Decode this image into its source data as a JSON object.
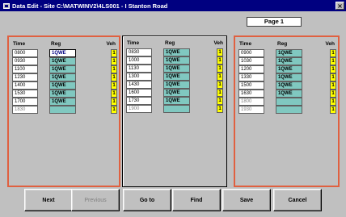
{
  "window": {
    "title": "Data Edit - Site C:\\MATWINV2\\4LS001 - I Stanton Road",
    "close": "×"
  },
  "page_label": "Page 1",
  "headers": {
    "time": "Time",
    "reg": "Reg",
    "veh": "Veh"
  },
  "panels": [
    {
      "rows": [
        {
          "time": "0800",
          "reg": "1QWE",
          "veh": "1",
          "sel": true
        },
        {
          "time": "0930",
          "reg": "1QWE",
          "veh": "1"
        },
        {
          "time": "1100",
          "reg": "1QWE",
          "veh": "1"
        },
        {
          "time": "1230",
          "reg": "1QWE",
          "veh": "1"
        },
        {
          "time": "1400",
          "reg": "1QWE",
          "veh": "1"
        },
        {
          "time": "1530",
          "reg": "1QWE",
          "veh": "1"
        },
        {
          "time": "1700",
          "reg": "1QWE",
          "veh": "1"
        },
        {
          "time": "1830",
          "reg": "",
          "veh": "1"
        }
      ]
    },
    {
      "rows": [
        {
          "time": "0830",
          "reg": "1QWE",
          "veh": "1"
        },
        {
          "time": "1000",
          "reg": "1QWE",
          "veh": "1"
        },
        {
          "time": "1130",
          "reg": "1QWE",
          "veh": "1"
        },
        {
          "time": "1300",
          "reg": "1QWE",
          "veh": "1"
        },
        {
          "time": "1430",
          "reg": "1QWE",
          "veh": "1"
        },
        {
          "time": "1600",
          "reg": "1QWE",
          "veh": "1"
        },
        {
          "time": "1730",
          "reg": "1QWE",
          "veh": "1"
        },
        {
          "time": "1900",
          "reg": "",
          "veh": "1"
        }
      ]
    },
    {
      "rows": [
        {
          "time": "0900",
          "reg": "1QWE",
          "veh": "1"
        },
        {
          "time": "1030",
          "reg": "1QWE",
          "veh": "1"
        },
        {
          "time": "1200",
          "reg": "1QWE",
          "veh": "1"
        },
        {
          "time": "1330",
          "reg": "1QWE",
          "veh": "1"
        },
        {
          "time": "1500",
          "reg": "1QWE",
          "veh": "1"
        },
        {
          "time": "1630",
          "reg": "1QWE",
          "veh": "1"
        },
        {
          "time": "1800",
          "reg": "",
          "veh": "1"
        },
        {
          "time": "1930",
          "reg": "",
          "veh": "1"
        }
      ]
    }
  ],
  "buttons": {
    "next": "Next",
    "previous": "Previous",
    "goto": "Go to",
    "find": "Find",
    "save": "Save",
    "cancel": "Cancel"
  },
  "colors": {
    "title_bg": "#000080",
    "reg_bg": "#80c8c0",
    "veh_bg": "#ffff00",
    "panel_border": "#e06040"
  }
}
